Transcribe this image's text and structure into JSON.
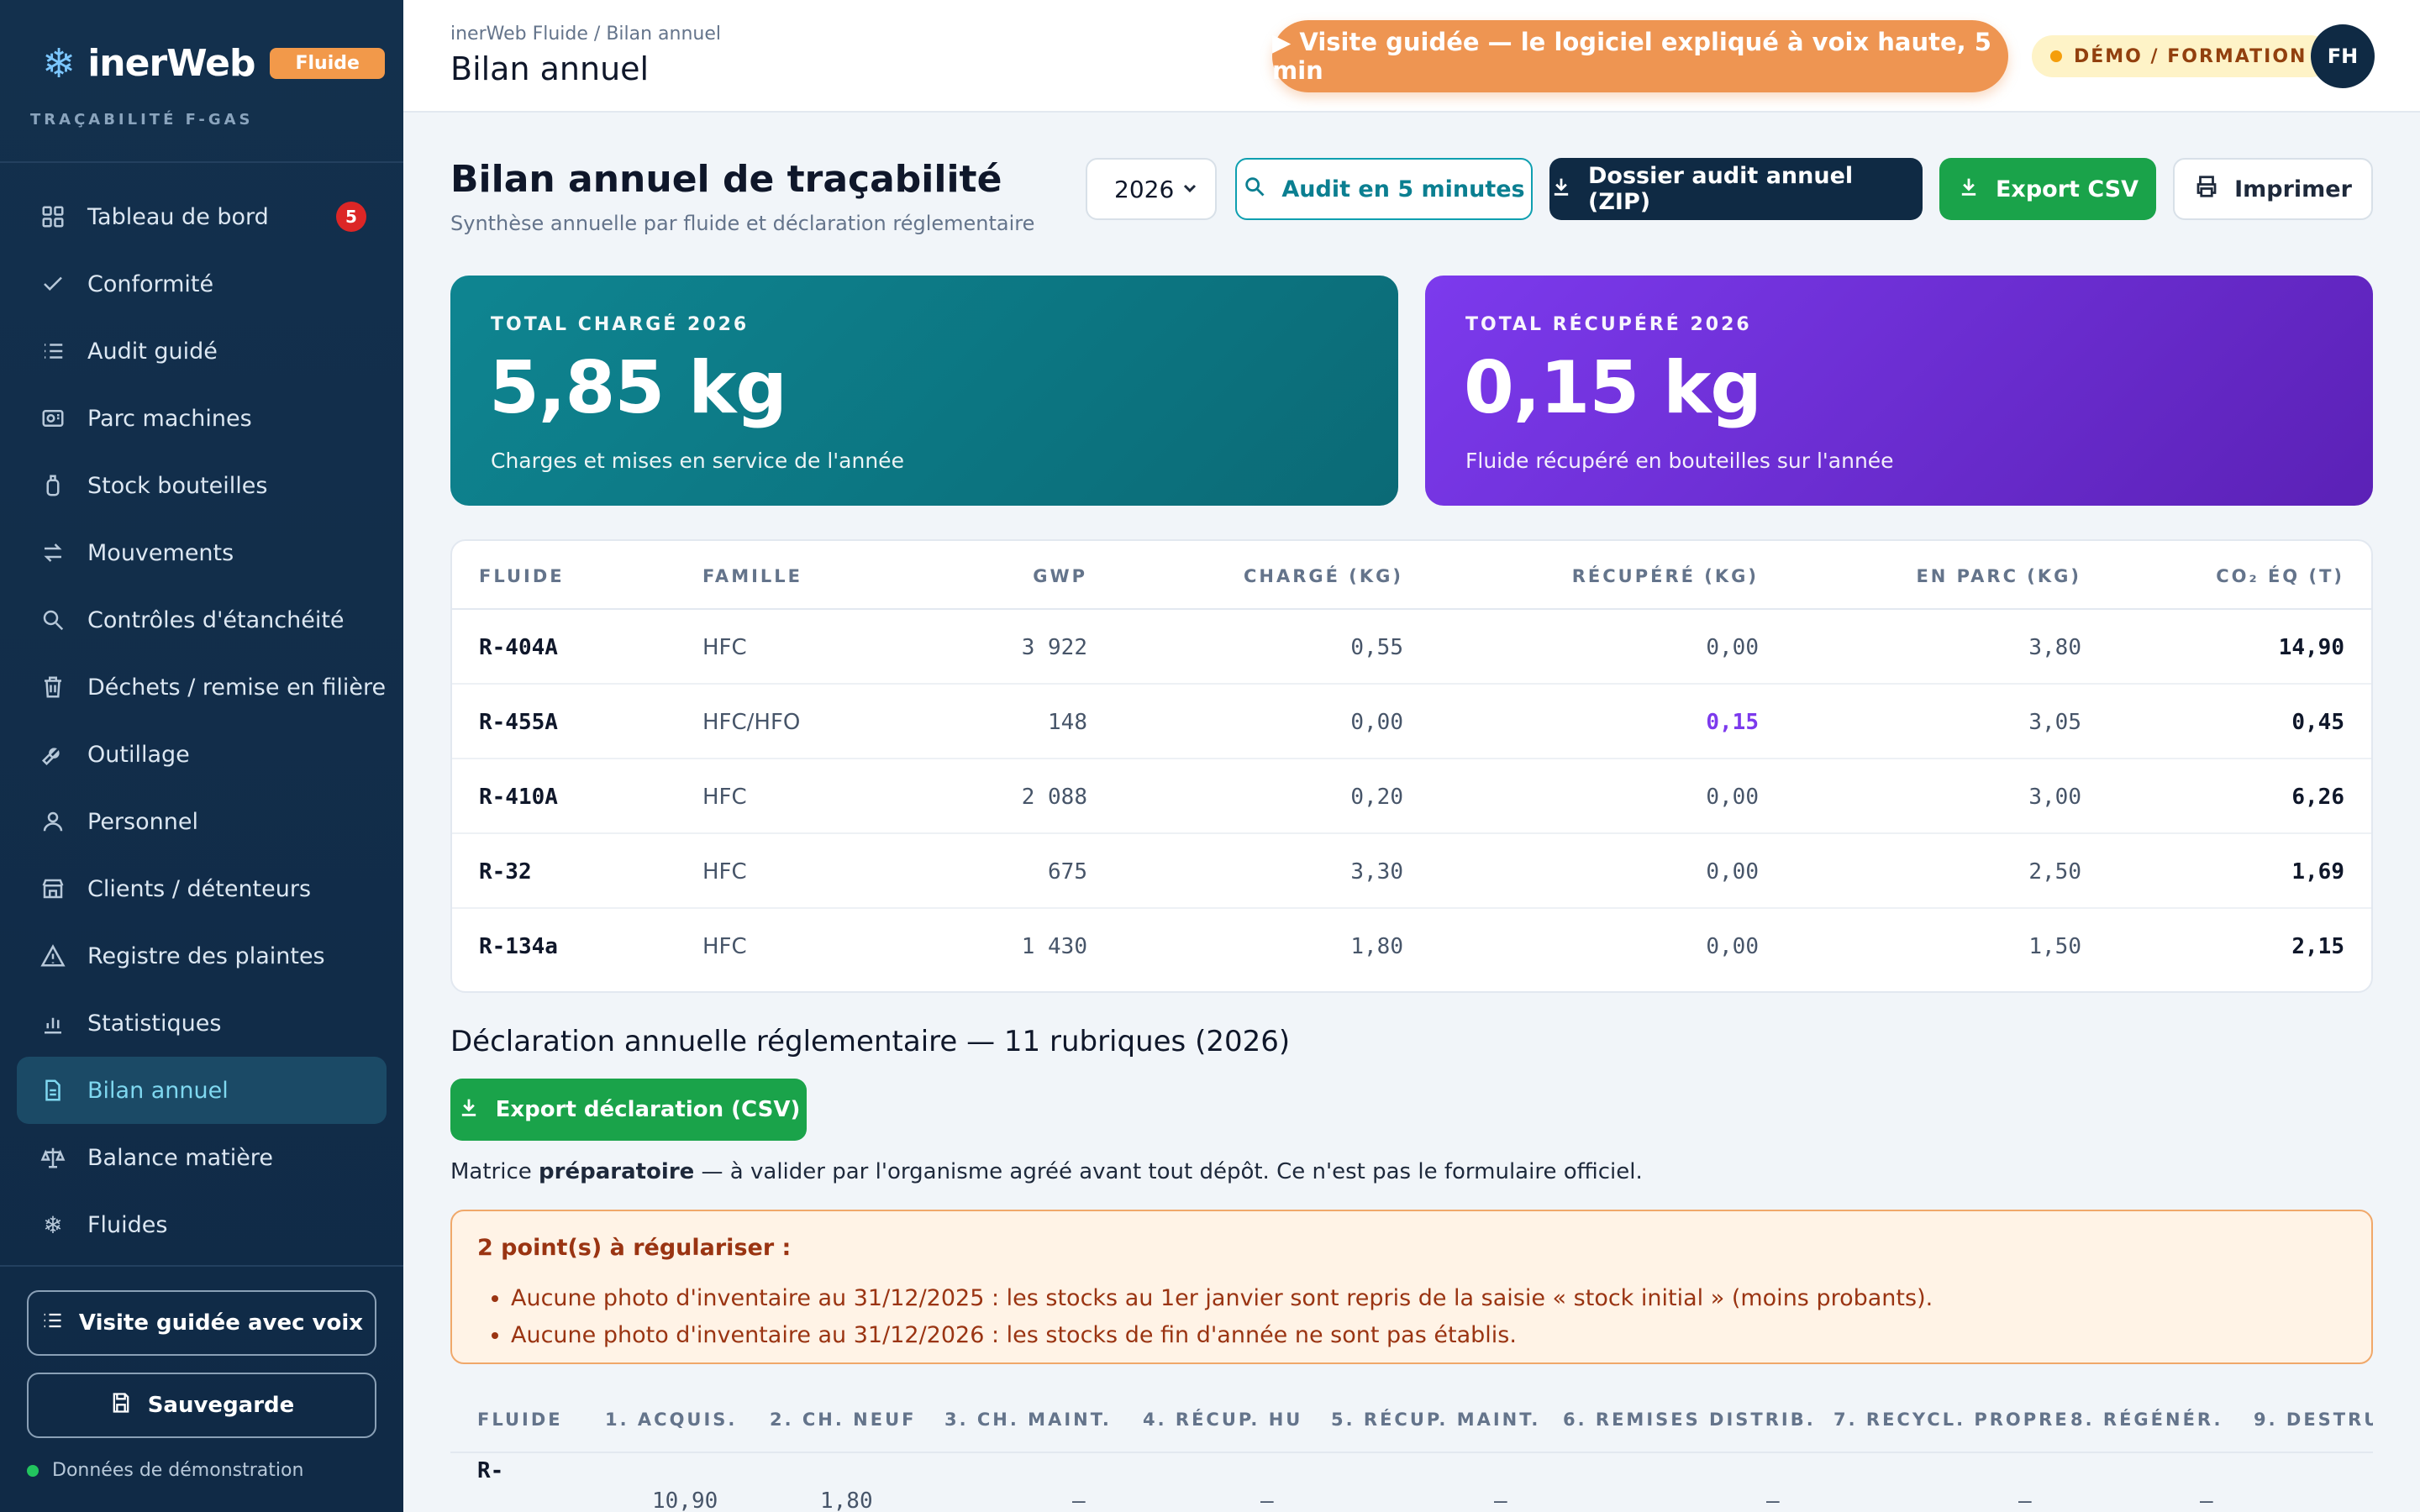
{
  "brand": {
    "name": "inerWeb",
    "badge": "Fluide",
    "subtitle": "TRAÇABILITÉ F-GAS"
  },
  "sidebar": {
    "items": [
      {
        "label": "Tableau de bord",
        "icon": "dashboard-icon",
        "count": "5"
      },
      {
        "label": "Conformité",
        "icon": "check-icon"
      },
      {
        "label": "Audit guidé",
        "icon": "list-icon"
      },
      {
        "label": "Parc machines",
        "icon": "machine-icon"
      },
      {
        "label": "Stock bouteilles",
        "icon": "bottle-icon"
      },
      {
        "label": "Mouvements",
        "icon": "arrows-icon"
      },
      {
        "label": "Contrôles d'étanchéité",
        "icon": "search-icon"
      },
      {
        "label": "Déchets / remise en filière",
        "icon": "trash-icon"
      },
      {
        "label": "Outillage",
        "icon": "wrench-icon"
      },
      {
        "label": "Personnel",
        "icon": "user-icon"
      },
      {
        "label": "Clients / détenteurs",
        "icon": "store-icon"
      },
      {
        "label": "Registre des plaintes",
        "icon": "warning-icon"
      },
      {
        "label": "Statistiques",
        "icon": "chart-icon"
      },
      {
        "label": "Bilan annuel",
        "icon": "document-icon",
        "active": true
      },
      {
        "label": "Balance matière",
        "icon": "scale-icon"
      },
      {
        "label": "Fluides",
        "icon": "snowflake-icon"
      }
    ],
    "tour_button": "Visite guidée avec voix",
    "save_button": "Sauvegarde",
    "footer": "Données de démonstration"
  },
  "topbar": {
    "breadcrumb": "inerWeb Fluide / Bilan annuel",
    "title": "Bilan annuel",
    "tour_button": "▶ Visite guidée — le logiciel expliqué à voix haute, 5 min",
    "demo_badge": "DÉMO / FORMATION",
    "avatar": "FH"
  },
  "page": {
    "title": "Bilan annuel de traçabilité",
    "subtitle": "Synthèse annuelle par fluide et déclaration réglementaire",
    "year": "2026",
    "btn_audit": "Audit en 5 minutes",
    "btn_zip": "Dossier audit annuel (ZIP)",
    "btn_csv": "Export CSV",
    "btn_print": "Imprimer"
  },
  "cards": {
    "charged": {
      "label": "TOTAL CHARGÉ 2026",
      "value": "5,85 kg",
      "sub": "Charges et mises en service de l'année",
      "color": "#0e8591"
    },
    "recovered": {
      "label": "TOTAL RÉCUPÉRÉ 2026",
      "value": "0,15 kg",
      "sub": "Fluide récupéré en bouteilles sur l'année",
      "color": "#7c3aed"
    }
  },
  "table": {
    "headers": {
      "fluid": "FLUIDE",
      "family": "FAMILLE",
      "gwp": "GWP",
      "charged": "CHARGÉ (KG)",
      "recovered": "RÉCUPÉRÉ (KG)",
      "fleet": "EN PARC (KG)",
      "co2": "CO₂ ÉQ (T)"
    },
    "rows": [
      {
        "fluid": "R-404A",
        "family": "HFC",
        "gwp": "3 922",
        "charged": "0,55",
        "recovered": "0,00",
        "fleet": "3,80",
        "co2": "14,90"
      },
      {
        "fluid": "R-455A",
        "family": "HFC/HFO",
        "gwp": "148",
        "charged": "0,00",
        "recovered": "0,15",
        "fleet": "3,05",
        "co2": "0,45"
      },
      {
        "fluid": "R-410A",
        "family": "HFC",
        "gwp": "2 088",
        "charged": "0,20",
        "recovered": "0,00",
        "fleet": "3,00",
        "co2": "6,26"
      },
      {
        "fluid": "R-32",
        "family": "HFC",
        "gwp": "675",
        "charged": "3,30",
        "recovered": "0,00",
        "fleet": "2,50",
        "co2": "1,69"
      },
      {
        "fluid": "R-134a",
        "family": "HFC",
        "gwp": "1 430",
        "charged": "1,80",
        "recovered": "0,00",
        "fleet": "1,50",
        "co2": "2,15"
      }
    ]
  },
  "declaration": {
    "title": "Déclaration annuelle réglementaire — 11 rubriques (2026)",
    "export_button": "Export déclaration (CSV)",
    "note_prefix": "Matrice",
    "note_bold": "préparatoire",
    "note_suffix": "— à valider par l'organisme agréé avant tout dépôt. Ce n'est pas le formulaire officiel.",
    "warning_title": "2 point(s) à régulariser :",
    "warnings": [
      "Aucune photo d'inventaire au 31/12/2025 : les stocks au 1er janvier sont repris de la saisie « stock initial » (moins probants).",
      "Aucune photo d'inventaire au 31/12/2026 : les stocks de fin d'année ne sont pas établis."
    ],
    "headers": [
      "FLUIDE",
      "1. ACQUIS.",
      "2. CH. NEUF",
      "3. CH. MAINT.",
      "4. RÉCUP. HU",
      "5. RÉCUP. MAINT.",
      "6. REMISES DISTRIB.",
      "7. RECYCL. PROPRE",
      "8. RÉGÉNÉR.",
      "9. DESTRU"
    ],
    "first_row": [
      "R-",
      "10,90",
      "1,80",
      "—",
      "—",
      "—",
      "—",
      "—",
      "—"
    ]
  }
}
